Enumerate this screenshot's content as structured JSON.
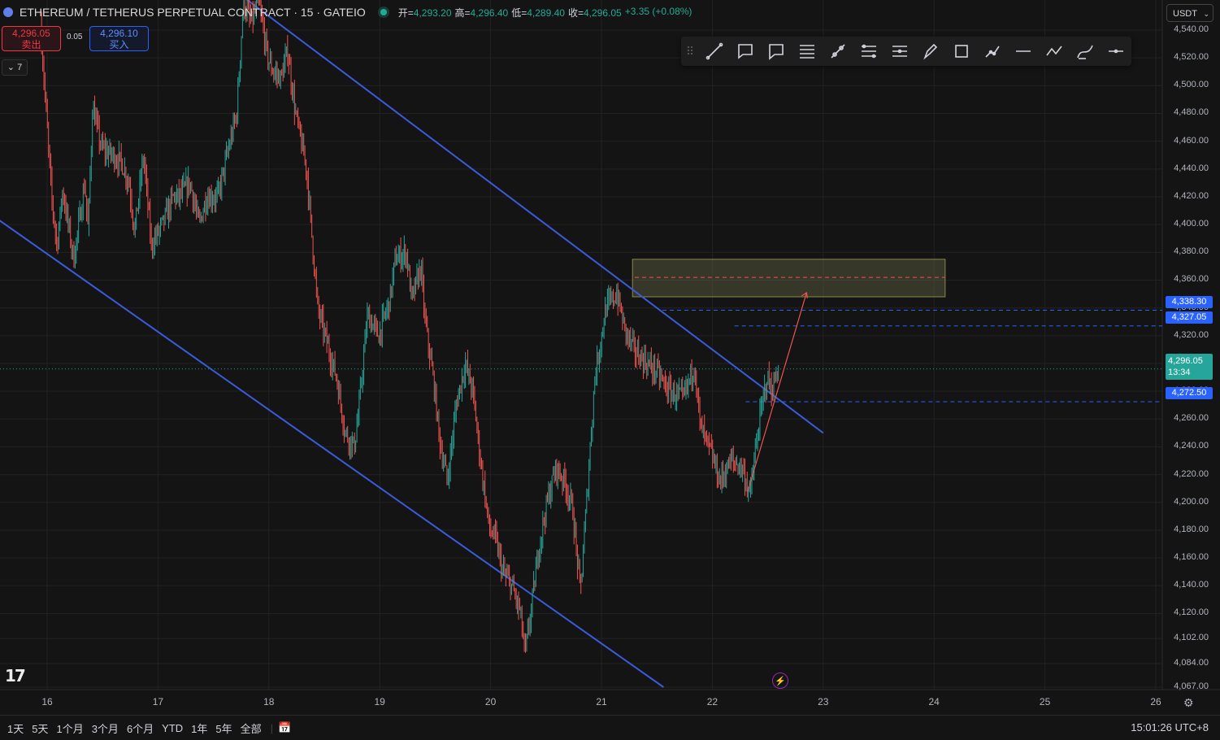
{
  "header": {
    "title": "ETHEREUM / TETHERUS PERPETUAL CONTRACT · 15 · GATEIO",
    "ohlc": [
      {
        "label": "开=",
        "value": "4,293.20"
      },
      {
        "label": "高=",
        "value": "4,296.40"
      },
      {
        "label": "低=",
        "value": "4,289.40"
      },
      {
        "label": "收=",
        "value": "4,296.05"
      },
      {
        "label": "",
        "value": "+3.35 (+0.08%)"
      }
    ]
  },
  "trade": {
    "sell_price": "4,296.05",
    "sell_label": "卖出",
    "spread": "0.05",
    "buy_price": "4,296.10",
    "buy_label": "买入",
    "indicator_count": "7",
    "collapse_icon": "chevron-down-icon"
  },
  "currency": "USDT",
  "toolbar_tools": [
    "trend-line-icon",
    "callout-icon",
    "comment-icon",
    "fib-retracement-icon",
    "ray-icon",
    "parallel-channel-icon",
    "regression-trend-icon",
    "brush-icon",
    "rectangle-icon",
    "path-icon",
    "horizontal-line-icon",
    "polyline-icon",
    "curve-icon",
    "horizontal-ray-icon"
  ],
  "y_axis": [
    "4,540.00",
    "4,520.00",
    "4,500.00",
    "4,480.00",
    "4,460.00",
    "4,440.00",
    "4,420.00",
    "4,400.00",
    "4,380.00",
    "4,360.00",
    "4,340.00",
    "4,320.00",
    "4,300.00",
    "4,280.00",
    "4,260.00",
    "4,240.00",
    "4,220.00",
    "4,200.00",
    "4,180.00",
    "4,160.00",
    "4,140.00",
    "4,120.00",
    "4,102.00",
    "4,084.00",
    "4,067.00"
  ],
  "x_axis": [
    "16",
    "17",
    "18",
    "19",
    "20",
    "21",
    "22",
    "23",
    "24",
    "25",
    "26"
  ],
  "price_labels": [
    {
      "value": "4,338.30",
      "color": "#2962ff"
    },
    {
      "value": "4,327.05",
      "color": "#2962ff"
    },
    {
      "value": "4,272.50",
      "color": "#2962ff"
    }
  ],
  "current_price": {
    "value": "4,296.05",
    "countdown": "13:34",
    "color": "#26a69a"
  },
  "range_buttons": [
    "1天",
    "5天",
    "1个月",
    "3个月",
    "6个月",
    "YTD",
    "1年",
    "5年",
    "全部"
  ],
  "timezone": "15:01:26 UTC+8",
  "colors": {
    "up": "#26a69a",
    "down": "#ef5350",
    "channel": "#3a5bdb",
    "accent": "#2962ff"
  },
  "chart_data": {
    "type": "candlestick",
    "symbol": "ETHEREUM / TETHERUS PERPETUAL CONTRACT",
    "interval": "15",
    "exchange": "GATEIO",
    "path": [
      [
        15.95,
        4545
      ],
      [
        16.05,
        4420
      ],
      [
        16.1,
        4385
      ],
      [
        16.15,
        4425
      ],
      [
        16.25,
        4375
      ],
      [
        16.35,
        4430
      ],
      [
        16.38,
        4395
      ],
      [
        16.42,
        4485
      ],
      [
        16.5,
        4455
      ],
      [
        16.6,
        4450
      ],
      [
        16.68,
        4445
      ],
      [
        16.75,
        4430
      ],
      [
        16.8,
        4395
      ],
      [
        16.88,
        4450
      ],
      [
        16.95,
        4385
      ],
      [
        17.05,
        4400
      ],
      [
        17.15,
        4420
      ],
      [
        17.2,
        4420
      ],
      [
        17.3,
        4430
      ],
      [
        17.38,
        4400
      ],
      [
        17.45,
        4420
      ],
      [
        17.55,
        4420
      ],
      [
        17.62,
        4445
      ],
      [
        17.72,
        4480
      ],
      [
        17.78,
        4560
      ],
      [
        17.85,
        4545
      ],
      [
        17.92,
        4560
      ],
      [
        18.0,
        4520
      ],
      [
        18.05,
        4510
      ],
      [
        18.12,
        4505
      ],
      [
        18.18,
        4525
      ],
      [
        18.25,
        4480
      ],
      [
        18.35,
        4440
      ],
      [
        18.45,
        4340
      ],
      [
        18.55,
        4310
      ],
      [
        18.62,
        4290
      ],
      [
        18.7,
        4250
      ],
      [
        18.78,
        4240
      ],
      [
        18.82,
        4265
      ],
      [
        18.9,
        4335
      ],
      [
        19.0,
        4320
      ],
      [
        19.1,
        4345
      ],
      [
        19.15,
        4375
      ],
      [
        19.25,
        4380
      ],
      [
        19.3,
        4345
      ],
      [
        19.38,
        4370
      ],
      [
        19.42,
        4330
      ],
      [
        19.5,
        4285
      ],
      [
        19.55,
        4245
      ],
      [
        19.62,
        4215
      ],
      [
        19.7,
        4270
      ],
      [
        19.78,
        4300
      ],
      [
        19.85,
        4280
      ],
      [
        19.92,
        4230
      ],
      [
        20.0,
        4180
      ],
      [
        20.05,
        4175
      ],
      [
        20.12,
        4150
      ],
      [
        20.2,
        4140
      ],
      [
        20.28,
        4120
      ],
      [
        20.32,
        4090
      ],
      [
        20.38,
        4125
      ],
      [
        20.45,
        4170
      ],
      [
        20.52,
        4200
      ],
      [
        20.6,
        4225
      ],
      [
        20.68,
        4215
      ],
      [
        20.75,
        4195
      ],
      [
        20.82,
        4135
      ],
      [
        20.88,
        4205
      ],
      [
        20.95,
        4290
      ],
      [
        21.05,
        4340
      ],
      [
        21.15,
        4350
      ],
      [
        21.22,
        4325
      ],
      [
        21.3,
        4310
      ],
      [
        21.42,
        4300
      ],
      [
        21.5,
        4295
      ],
      [
        21.62,
        4280
      ],
      [
        21.75,
        4275
      ],
      [
        21.85,
        4300
      ],
      [
        21.9,
        4255
      ],
      [
        22.0,
        4235
      ],
      [
        22.08,
        4215
      ],
      [
        22.18,
        4230
      ],
      [
        22.28,
        4225
      ],
      [
        22.35,
        4205
      ],
      [
        22.42,
        4250
      ],
      [
        22.5,
        4290
      ],
      [
        22.55,
        4280
      ],
      [
        22.6,
        4296
      ]
    ]
  }
}
